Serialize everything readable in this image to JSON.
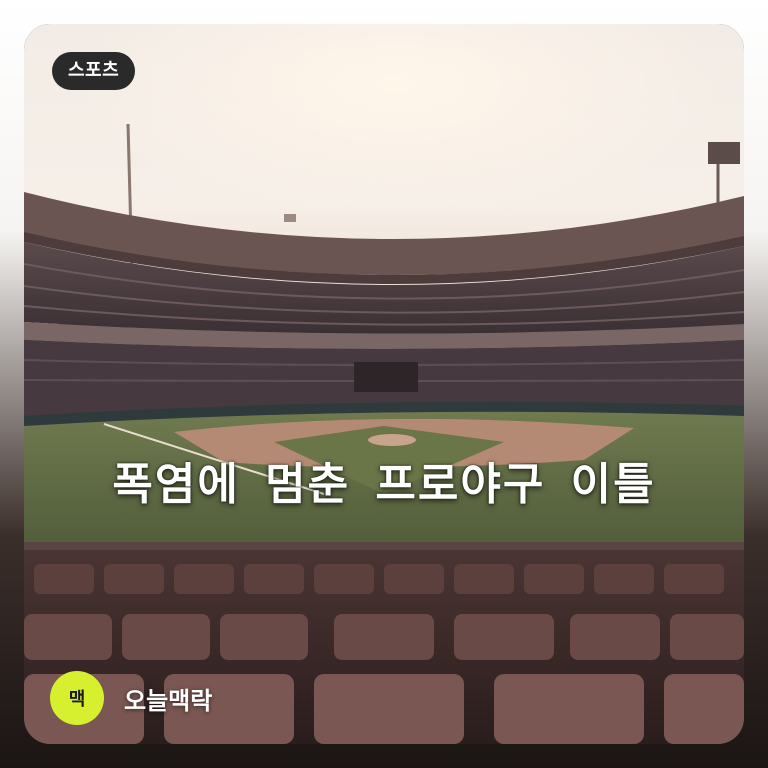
{
  "category": {
    "label": "스포츠"
  },
  "headline": {
    "text": "폭염에 멈춘 프로야구 이틀"
  },
  "brand": {
    "badge_text": "맥",
    "name": "오늘맥락",
    "badge_color": "#d6ef2f"
  },
  "image": {
    "subject": "empty baseball stadium at sunset"
  },
  "colors": {
    "pill_bg": "#2a2a2a",
    "text": "#ffffff"
  }
}
